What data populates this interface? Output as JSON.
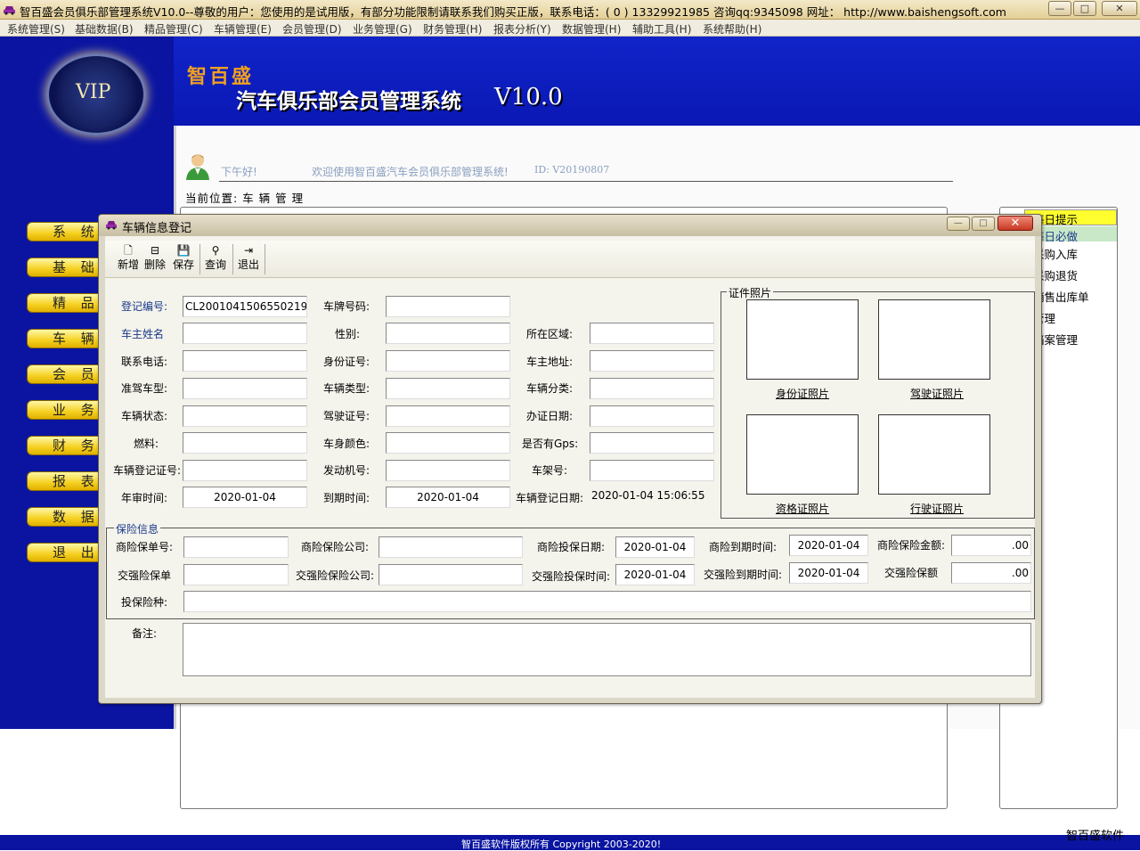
{
  "window": {
    "title": "智百盛会员俱乐部管理系统V10.0--尊敬的用户：您使用的是试用版，有部分功能限制请联系我们购买正版，联系电话：( 0 ) 13329921985  咨询qq:9345098   网址：  http://www.baishengsoft.com",
    "minimize": "—",
    "maximize": "□",
    "close": "✕"
  },
  "menu": [
    "系统管理(S)",
    "基础数据(B)",
    "精品管理(C)",
    "车辆管理(E)",
    "会员管理(D)",
    "业务管理(G)",
    "财务管理(H)",
    "报表分析(Y)",
    "数据管理(H)",
    "辅助工具(H)",
    "系统帮助(H)"
  ],
  "brand": {
    "vip": "VIP",
    "name": "智百盛",
    "system": "汽车俱乐部会员管理系统",
    "version": "V10.0"
  },
  "header": {
    "greeting": "下午好!",
    "welcome": "欢迎使用智百盛汽车会员俱乐部管理系统!",
    "id": "ID: V20190807",
    "position": "当前位置: 车 辆 管 理"
  },
  "nav": [
    "系 统 管",
    "基 础 数",
    "精 品 管",
    "车 辆 管",
    "会 员 管",
    "业 务 管",
    "财 务 管",
    "报 表 分",
    "数 据 管",
    "退 出 系"
  ],
  "right_panel": [
    "每日提示",
    "每日必做",
    "采购入库",
    "采购退货",
    "销售出库单",
    "管理",
    "档案管理"
  ],
  "dialog": {
    "title": "车辆信息登记",
    "toolbar": [
      {
        "icon": "new-doc-icon",
        "label": "新增",
        "glyph": "🗋"
      },
      {
        "icon": "delete-icon",
        "label": "删除",
        "glyph": "⊟"
      },
      {
        "icon": "save-icon",
        "label": "保存",
        "glyph": "💾"
      },
      {
        "icon": "binoculars-icon",
        "label": "查询",
        "glyph": "⚲"
      },
      {
        "icon": "exit-door-icon",
        "label": "退出",
        "glyph": "⇥"
      }
    ],
    "fields": {
      "reg_no": {
        "label": "登记编号:",
        "value": "CL2001041506550219"
      },
      "plate": {
        "label": "车牌号码:",
        "value": ""
      },
      "owner": {
        "label": "车主姓名",
        "value": ""
      },
      "gender": {
        "label": "性别:",
        "value": ""
      },
      "region": {
        "label": "所在区域:",
        "value": ""
      },
      "phone": {
        "label": "联系电话:",
        "value": ""
      },
      "idcard": {
        "label": "身份证号:",
        "value": ""
      },
      "address": {
        "label": "车主地址:",
        "value": ""
      },
      "license_type": {
        "label": "准驾车型:",
        "value": ""
      },
      "vehicle_type": {
        "label": "车辆类型:",
        "value": ""
      },
      "vehicle_class": {
        "label": "车辆分类:",
        "value": ""
      },
      "status": {
        "label": "车辆状态:",
        "value": ""
      },
      "license_no": {
        "label": "驾驶证号:",
        "value": ""
      },
      "issue_date": {
        "label": "办证日期:",
        "value": ""
      },
      "fuel": {
        "label": "燃料:",
        "value": ""
      },
      "color": {
        "label": "车身颜色:",
        "value": ""
      },
      "gps": {
        "label": "是否有Gps:",
        "value": ""
      },
      "reg_cert": {
        "label": "车辆登记证号:",
        "value": ""
      },
      "engine": {
        "label": "发动机号:",
        "value": ""
      },
      "frame": {
        "label": "车架号:",
        "value": ""
      },
      "inspect": {
        "label": "年审时间:",
        "value": "2020-01-04"
      },
      "expire": {
        "label": "到期时间:",
        "value": "2020-01-04"
      },
      "reg_date": {
        "label": "车辆登记日期:",
        "value": "2020-01-04 15:06:55"
      }
    },
    "photos": {
      "legend": "证件照片",
      "idcard": "身份证照片",
      "driver": "驾驶证照片",
      "qualify": "资格证照片",
      "vehicle": "行驶证照片"
    },
    "insurance": {
      "legend": "保险信息",
      "com_no": {
        "label": "商险保单号:",
        "value": ""
      },
      "com_company": {
        "label": "商险保险公司:",
        "value": ""
      },
      "com_start": {
        "label": "商险投保日期:",
        "value": "2020-01-04"
      },
      "com_end": {
        "label": "商险到期时间:",
        "value": "2020-01-04"
      },
      "com_amount": {
        "label": "商险保险金额:",
        "value": ".00"
      },
      "cmp_no": {
        "label": "交强险保单",
        "value": ""
      },
      "cmp_company": {
        "label": "交强险保险公司:",
        "value": ""
      },
      "cmp_start": {
        "label": "交强险投保时间:",
        "value": "2020-01-04"
      },
      "cmp_end": {
        "label": "交强险到期时间:",
        "value": "2020-01-04"
      },
      "cmp_amount": {
        "label": "交强险保额",
        "value": ".00"
      },
      "kinds": {
        "label": "投保险种:",
        "value": ""
      }
    },
    "remark": {
      "label": "备注:",
      "value": ""
    }
  },
  "footer": {
    "copyright": "智百盛软件版权所有 Copyright 2003-2020!",
    "brand": "智百盛软件"
  },
  "colors": {
    "blue": "#0a14a0",
    "nav_yellow": "#f5d020",
    "highlight_yellow": "#ffff30",
    "highlight_green": "#c8e8c8"
  }
}
